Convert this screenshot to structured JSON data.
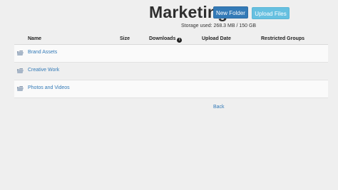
{
  "header": {
    "title": "Marketing",
    "new_folder_label": "New Folder",
    "upload_files_label": "Upload Files",
    "storage_text": "Storage used: 268.3 MB / 150 GB"
  },
  "table": {
    "columns": {
      "name": "Name",
      "size": "Size",
      "downloads": "Downloads",
      "upload_date": "Upload Date",
      "restricted_groups": "Restricted Groups"
    },
    "rows": [
      {
        "name": "Brand Assets",
        "icon": "folder-icon"
      },
      {
        "name": "Creative Work",
        "icon": "folder-icon"
      },
      {
        "name": "Photos and Videos",
        "icon": "folder-icon"
      }
    ]
  },
  "footer": {
    "back_label": "Back"
  },
  "colors": {
    "primary": "#337ab7",
    "info": "#66c0e0",
    "background": "#efefef"
  }
}
